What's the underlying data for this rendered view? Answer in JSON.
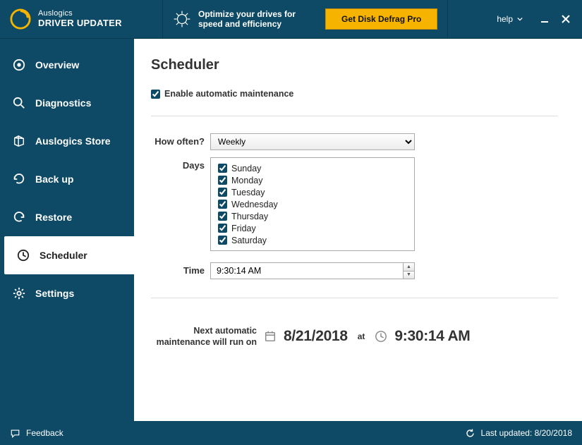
{
  "header": {
    "brand": "Auslogics",
    "product": "DRIVER UPDATER",
    "promo_text": "Optimize your drives for speed and efficiency",
    "promo_button": "Get Disk Defrag Pro",
    "help_label": "help"
  },
  "sidebar": {
    "items": [
      {
        "label": "Overview"
      },
      {
        "label": "Diagnostics"
      },
      {
        "label": "Auslogics Store"
      },
      {
        "label": "Back up"
      },
      {
        "label": "Restore"
      },
      {
        "label": "Scheduler"
      },
      {
        "label": "Settings"
      }
    ]
  },
  "scheduler": {
    "title": "Scheduler",
    "enable_label": "Enable automatic maintenance",
    "how_often_label": "How often?",
    "how_often_value": "Weekly",
    "days_label": "Days",
    "days": [
      {
        "label": "Sunday"
      },
      {
        "label": "Monday"
      },
      {
        "label": "Tuesday"
      },
      {
        "label": "Wednesday"
      },
      {
        "label": "Thursday"
      },
      {
        "label": "Friday"
      },
      {
        "label": "Saturday"
      }
    ],
    "time_label": "Time",
    "time_value": "9:30:14 AM",
    "next_run_label": "Next automatic maintenance will run on",
    "next_run_date": "8/21/2018",
    "next_run_at": "at",
    "next_run_time": "9:30:14 AM"
  },
  "footer": {
    "feedback_label": "Feedback",
    "last_updated_label": "Last updated: 8/20/2018"
  }
}
